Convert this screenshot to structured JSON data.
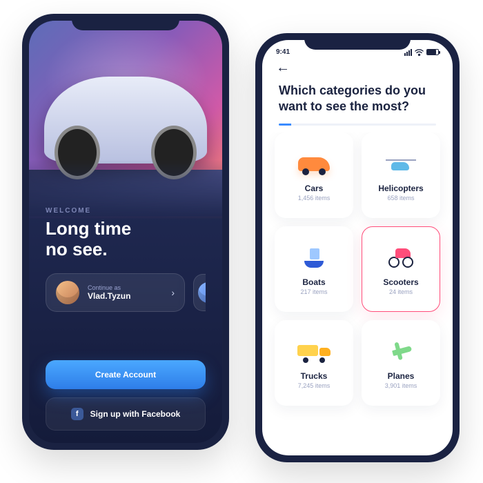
{
  "left": {
    "welcome_label": "WELCOME",
    "headline": "Long time\nno see.",
    "continue_as_label": "Continue as",
    "username": "Vlad.Tyzun",
    "create_account_label": "Create Account",
    "facebook_label": "Sign up with Facebook",
    "facebook_glyph": "f"
  },
  "right": {
    "status_time": "9:41",
    "question": "Which categories do you want to see the most?",
    "items_suffix": "items",
    "categories": [
      {
        "name": "Cars",
        "count": "1,456",
        "icon": "car",
        "selected": false
      },
      {
        "name": "Helicopters",
        "count": "658",
        "icon": "heli",
        "selected": false
      },
      {
        "name": "Boats",
        "count": "217",
        "icon": "boat",
        "selected": false
      },
      {
        "name": "Scooters",
        "count": "24",
        "icon": "scooter",
        "selected": true
      },
      {
        "name": "Trucks",
        "count": "7,245",
        "icon": "truck",
        "selected": false
      },
      {
        "name": "Planes",
        "count": "3,901",
        "icon": "plane",
        "selected": false
      }
    ]
  }
}
